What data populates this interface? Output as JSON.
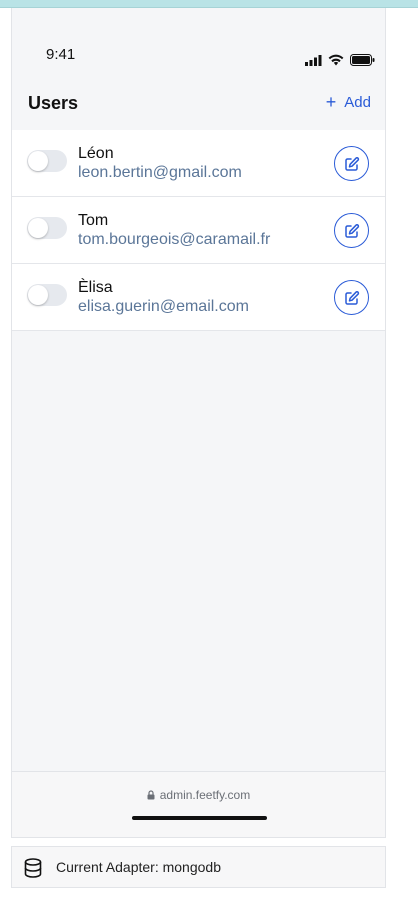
{
  "status_bar": {
    "time": "9:41",
    "icons": [
      "signal-icon",
      "wifi-icon",
      "battery-icon"
    ]
  },
  "header": {
    "title": "Users",
    "add_label": "Add",
    "add_icon": "plus-icon"
  },
  "users": [
    {
      "name": "Léon",
      "email": "leon.bertin@gmail.com",
      "enabled": false
    },
    {
      "name": "Tom",
      "email": "tom.bourgeois@caramail.fr",
      "enabled": false
    },
    {
      "name": "Èlisa",
      "email": "elisa.guerin@email.com",
      "enabled": false
    }
  ],
  "footer": {
    "url": "admin.feetfy.com",
    "url_icon": "lock-icon"
  },
  "adapter": {
    "label": "Current Adapter: mongodb",
    "icon": "database-icon"
  },
  "colors": {
    "accent": "#2a5bd7",
    "email": "#5b7698",
    "top_band": "#b9e3e6"
  }
}
